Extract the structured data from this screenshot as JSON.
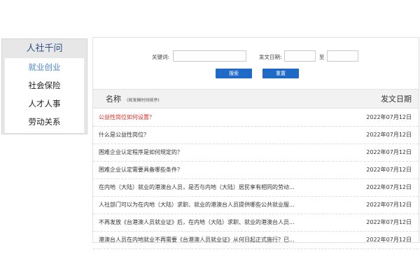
{
  "sidebar": {
    "title": "人社千问",
    "items": [
      {
        "label": "就业创业",
        "active": true
      },
      {
        "label": "社会保险",
        "active": false
      },
      {
        "label": "人才人事",
        "active": false
      },
      {
        "label": "劳动关系",
        "active": false
      }
    ]
  },
  "search": {
    "keyword_label": "关键词:",
    "keyword_value": "",
    "date_label": "发文日期:",
    "date_from": "",
    "date_to_label": "至",
    "date_to": "",
    "search_button": "搜索",
    "reset_button": "重置"
  },
  "list": {
    "header": {
      "name": "名称",
      "sort_hint": "(按发稿时间排序)",
      "date": "发文日期"
    },
    "rows": [
      {
        "title": "公益性岗位如何设置？",
        "date": "2022年07月12日",
        "highlight": true
      },
      {
        "title": "什么是公益性岗位？",
        "date": "2022年07月12日",
        "highlight": false
      },
      {
        "title": "困难企业认定程序是如何规定的？",
        "date": "2022年07月12日",
        "highlight": false
      },
      {
        "title": "困难企业认定需要具备哪些条件？",
        "date": "2022年07月12日",
        "highlight": false
      },
      {
        "title": "在内地（大陆）就业的港澳台人员，是否与内地（大陆）居民享有相同的劳动...",
        "date": "2022年07月12日",
        "highlight": false
      },
      {
        "title": "人社部门可以为在内地（大陆）求职、就业的港澳台人员提供哪些公共就业服...",
        "date": "2022年07月12日",
        "highlight": false
      },
      {
        "title": "不再发放《台港澳人员就业证》后，在内地（大陆）求职、就业的港澳台人员...",
        "date": "2022年07月12日",
        "highlight": false
      },
      {
        "title": "港澳台人员在内地就业不再需要《台港澳人员就业证》从何日起正式施行？已...",
        "date": "2022年07月12日",
        "highlight": false
      }
    ]
  },
  "colors": {
    "primary_button": "#1e6ac6",
    "active_nav": "#4a86c8",
    "highlight_row": "#d9302a",
    "sidebar_title": "#2c4f86"
  }
}
